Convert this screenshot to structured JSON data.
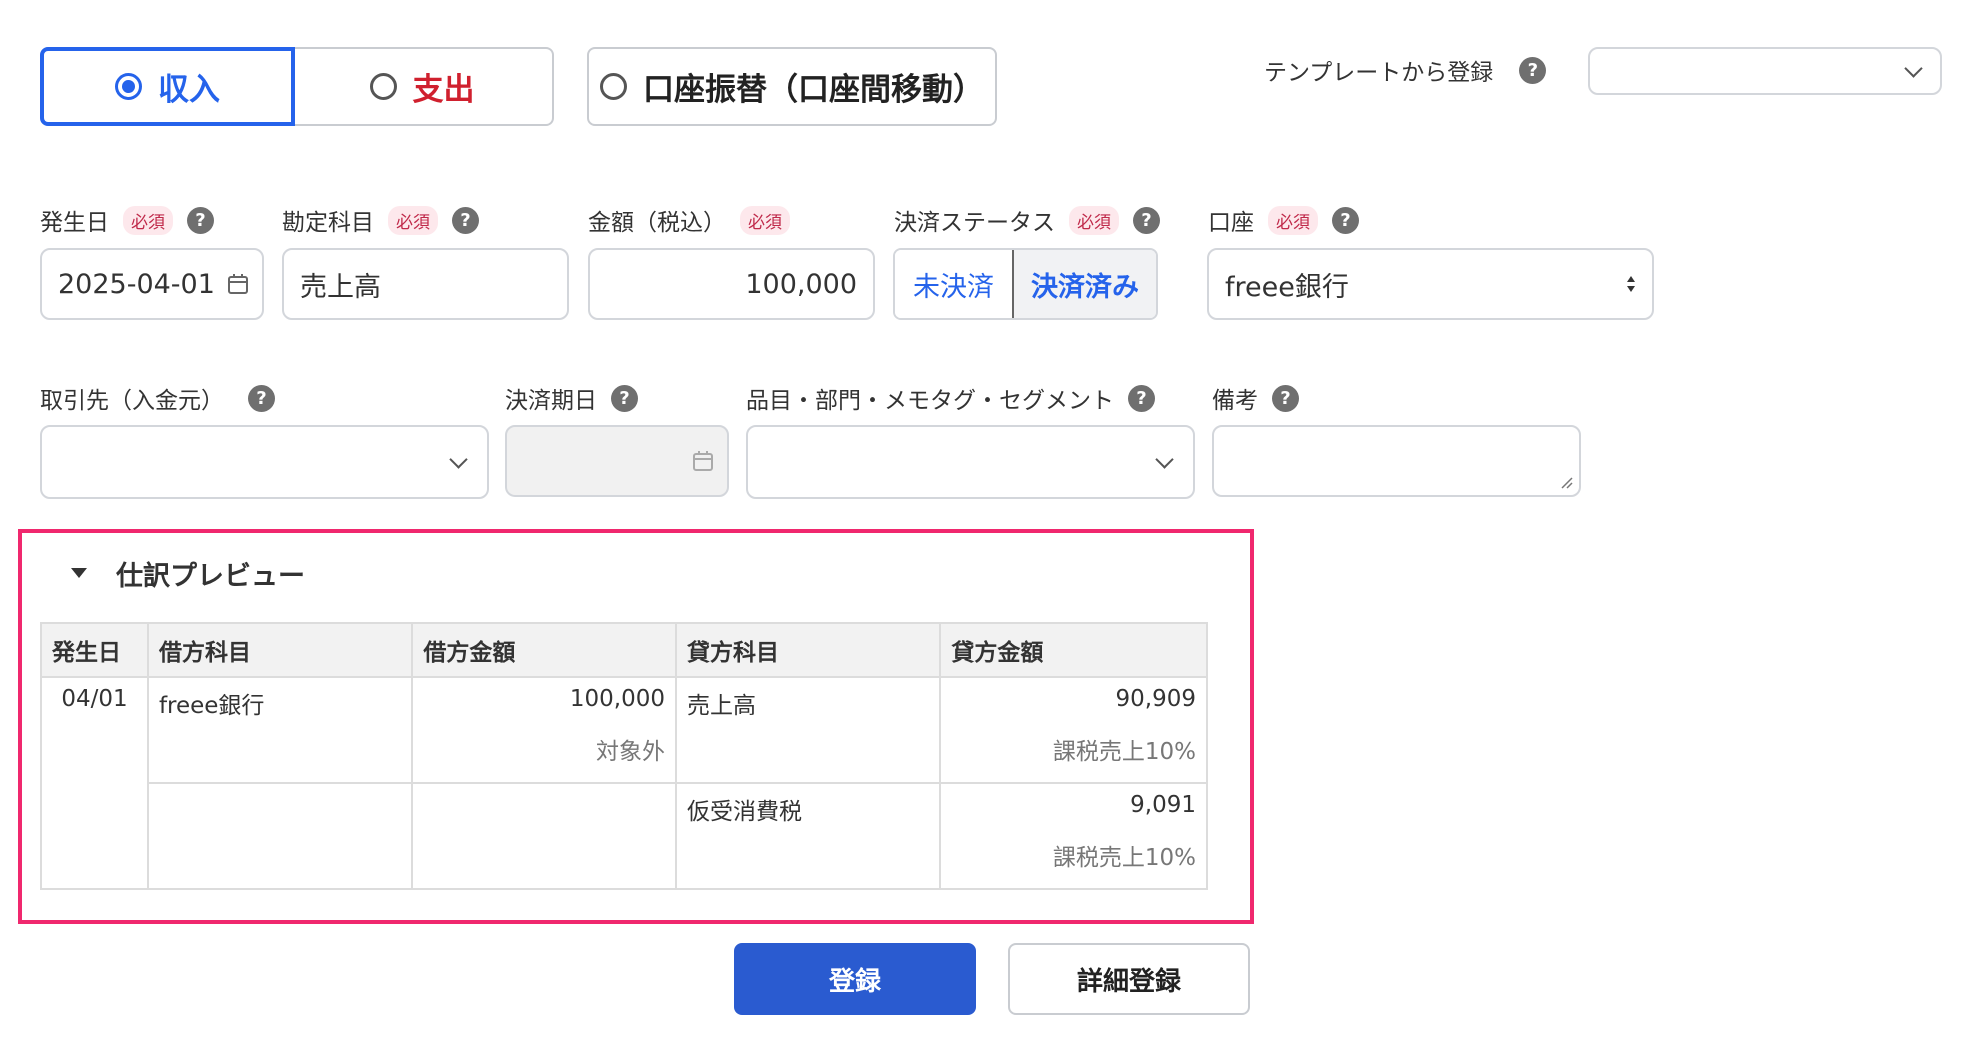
{
  "type_tabs": [
    {
      "label": "収入",
      "selected": true
    },
    {
      "label": "支出",
      "selected": false
    },
    {
      "label": "口座振替（口座間移動）",
      "selected": false
    }
  ],
  "template": {
    "label": "テンプレートから登録",
    "value": ""
  },
  "help_glyph": "?",
  "required_badge": "必須",
  "fields_row1": {
    "date": {
      "label": "発生日",
      "value": "2025-04-01"
    },
    "account_item": {
      "label": "勘定科目",
      "value": "売上高"
    },
    "amount": {
      "label": "金額（税込）",
      "value": "100,000"
    },
    "payment_status": {
      "label": "決済ステータス",
      "options": [
        "未決済",
        "決済済み"
      ],
      "selected": "決済済み"
    },
    "wallet": {
      "label": "口座",
      "value": "freee銀行"
    }
  },
  "fields_row2": {
    "partner": {
      "label": "取引先（入金元）",
      "value": ""
    },
    "due_date": {
      "label": "決済期日",
      "value": ""
    },
    "tags": {
      "label": "品目・部門・メモタグ・セグメント",
      "value": ""
    },
    "memo": {
      "label": "備考",
      "value": ""
    }
  },
  "preview": {
    "title": "仕訳プレビュー",
    "headers": [
      "発生日",
      "借方科目",
      "借方金額",
      "貸方科目",
      "貸方金額"
    ],
    "date": "04/01",
    "rows": [
      {
        "debit_account": "freee銀行",
        "debit_amount": "100,000",
        "debit_tax": "対象外",
        "credit_account": "売上高",
        "credit_amount": "90,909",
        "credit_tax": "課税売上10%"
      },
      {
        "debit_account": "",
        "debit_amount": "",
        "debit_tax": "",
        "credit_account": "仮受消費税",
        "credit_amount": "9,091",
        "credit_tax": "課税売上10%"
      }
    ]
  },
  "actions": {
    "register": "登録",
    "detail_register": "詳細登録"
  },
  "colors": {
    "accent_blue": "#2563eb",
    "expense_red": "#d0202e",
    "highlight_pink": "#f0286e",
    "primary_button": "#2a5bd0"
  }
}
